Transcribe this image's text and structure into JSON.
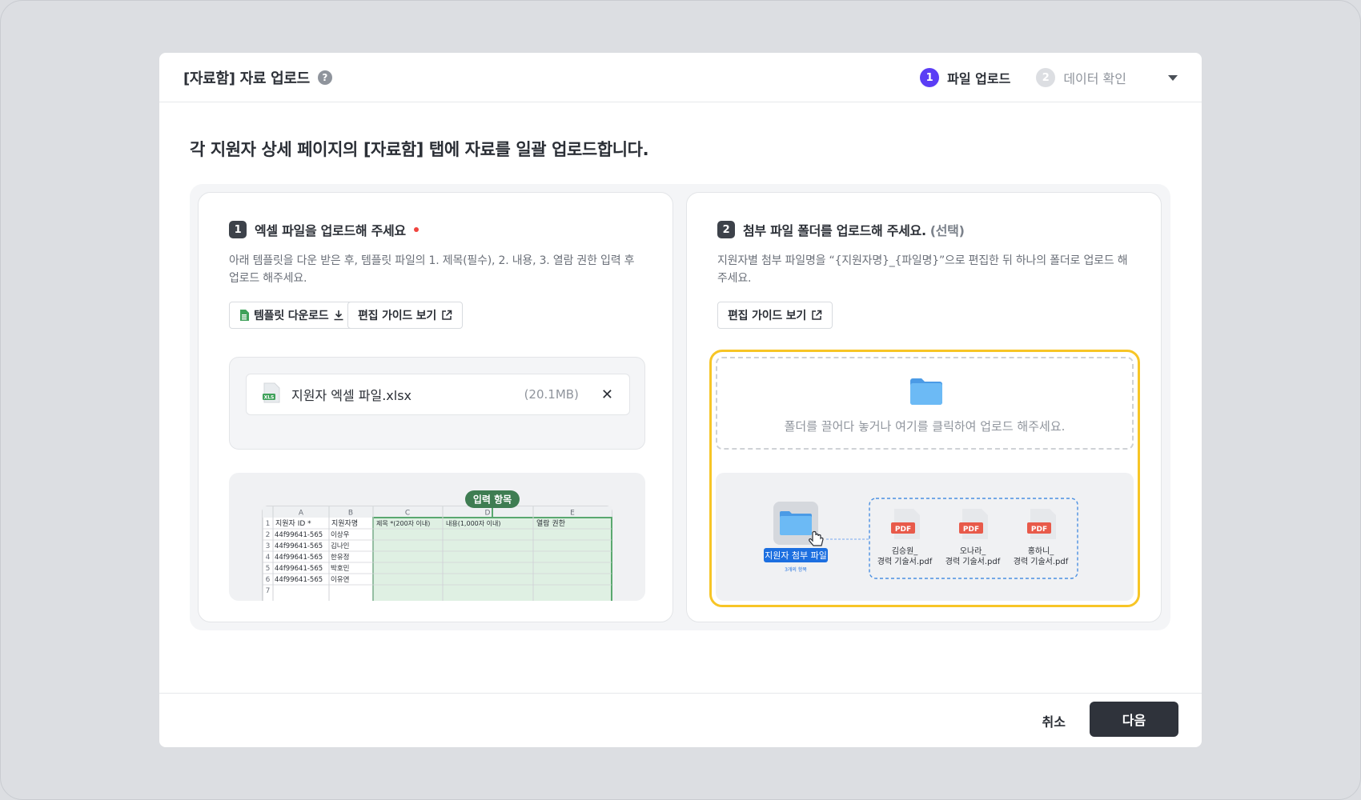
{
  "modal": {
    "title": "[자료함] 자료 업로드",
    "help_icon": "?",
    "steps": [
      {
        "num": "1",
        "label": "파일 업로드",
        "state": "active"
      },
      {
        "num": "2",
        "label": "데이터 확인",
        "state": "inactive"
      }
    ],
    "heading": "각 지원자 상세 페이지의 [자료함] 탭에 자료를 일괄 업로드합니다."
  },
  "left_panel": {
    "num": "1",
    "title": "엑셀 파일을 업로드해 주세요",
    "desc": "아래 템플릿을 다운 받은 후, 템플릿 파일의  1. 제목(필수), 2. 내용, 3. 열람 권한 입력 후 업로드 해주세요.",
    "template_button": "템플릿 다운로드",
    "guide_button": "편집 가이드 보기",
    "file": {
      "name": "지원자 엑셀 파일.xlsx",
      "size": "(20.1MB)",
      "icon_text": "XLS"
    },
    "sheet": {
      "badge": "입력 항목",
      "col_letters": [
        "A",
        "B",
        "C",
        "D",
        "E"
      ],
      "header": [
        "지원자 ID *",
        "지원자명",
        "제목 *(200자 이내)",
        "내용(1,000자 이내)",
        "열람 권한"
      ],
      "rows": [
        {
          "n": "1",
          "id": "",
          "name": ""
        },
        {
          "n": "2",
          "id": "44f99641-565",
          "name": "이상우"
        },
        {
          "n": "3",
          "id": "44f99641-565",
          "name": "김나인"
        },
        {
          "n": "4",
          "id": "44f99641-565",
          "name": "한유정"
        },
        {
          "n": "5",
          "id": "44f99641-565",
          "name": "박호민"
        },
        {
          "n": "6",
          "id": "44f99641-565",
          "name": "이유연"
        },
        {
          "n": "7",
          "id": "",
          "name": ""
        }
      ]
    }
  },
  "right_panel": {
    "num": "2",
    "title": "첨부 파일 폴더를 업로드해 주세요.",
    "optional": "(선택)",
    "desc": "지원자별 첨부 파일명을 “{지원자명}_{파일명}”으로 편집한 뒤 하나의 폴더로 업로드 해 주세요.",
    "guide_button": "편집 가이드 보기",
    "drop_text": "폴더를 끌어다 놓거나 여기를 클릭하여 업로드 해주세요.",
    "example": {
      "folder_label": "지원자 첨부 파일",
      "folder_sub": "3개의 항목",
      "files": [
        {
          "icon": "PDF",
          "line1": "김승원_",
          "line2": "경력 기술서.pdf"
        },
        {
          "icon": "PDF",
          "line1": "오나라_",
          "line2": "경력 기술서.pdf"
        },
        {
          "icon": "PDF",
          "line1": "홍하니_",
          "line2": "경력 기술서.pdf"
        }
      ]
    }
  },
  "footer": {
    "cancel": "취소",
    "next": "다음"
  },
  "colors": {
    "accent": "#5b3df5",
    "highlight": "#f7c526",
    "sheet_green": "#5aa86f",
    "pdf_red": "#e85a4a",
    "folder_blue": "#5aaef0",
    "primary_button": "#2f333b"
  }
}
